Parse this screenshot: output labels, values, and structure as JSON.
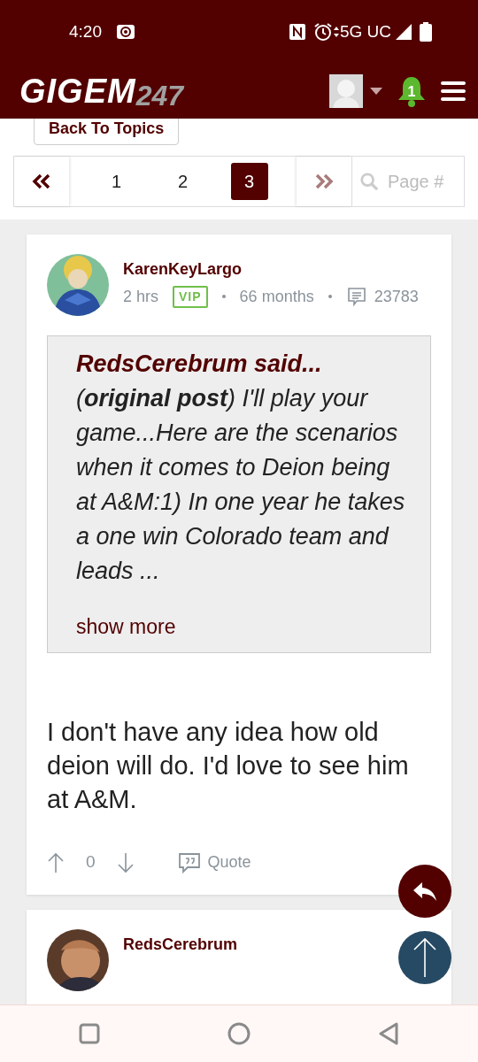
{
  "status_bar": {
    "time": "4:20",
    "network": "5G UC"
  },
  "header": {
    "logo_main": "GIGEM",
    "logo_suffix": "247",
    "notification_count": "1"
  },
  "back_button": "Back To Topics",
  "pagination": {
    "pages": [
      {
        "label": "1",
        "selected": false
      },
      {
        "label": "2",
        "selected": false
      },
      {
        "label": "3",
        "selected": true
      }
    ],
    "placeholder": "Page #"
  },
  "posts": [
    {
      "author": "KarenKeyLargo",
      "time": "2 hrs",
      "badge": "VIP",
      "tenure": "66 months",
      "post_count": "23783",
      "quote": {
        "title": "RedsCerebrum said...",
        "text": "(**original post**) I'll play your game...Here are the scenarios when it comes to Deion being at A&M:1) In one year he takes a one win Colorado team and leads ...",
        "more": "show more"
      },
      "body": "I don't have any idea how old deion will do. I'd love to see him at A&M.",
      "votes": "0",
      "quote_action": "Quote"
    },
    {
      "author": "RedsCerebrum"
    }
  ]
}
